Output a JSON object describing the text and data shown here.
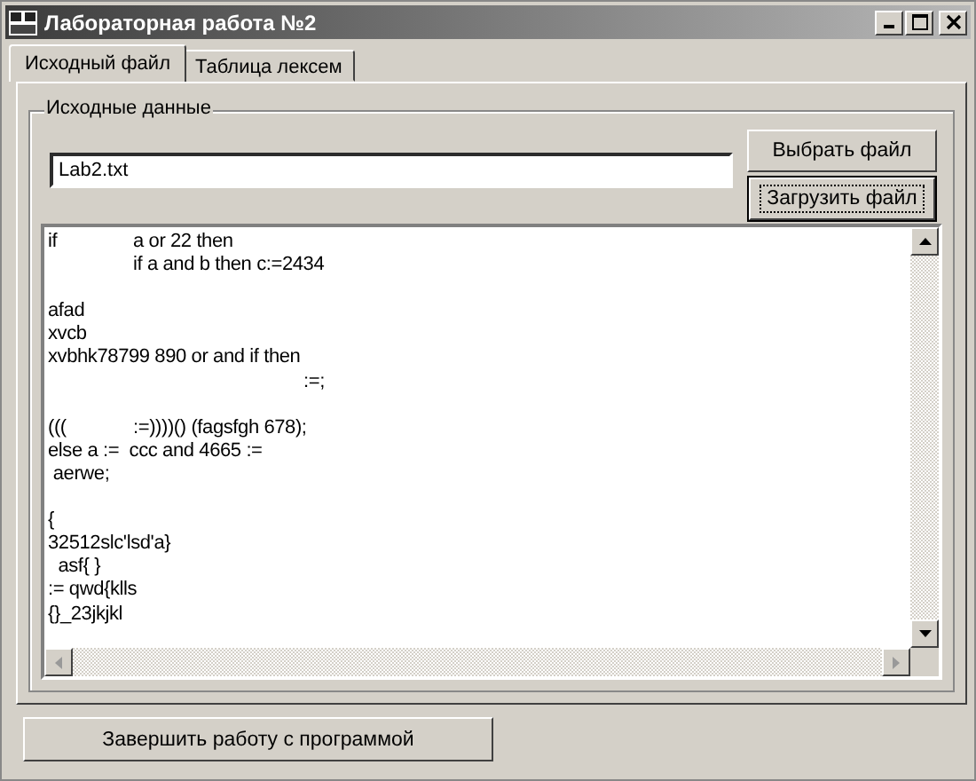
{
  "window": {
    "title": "Лабораторная работа №2"
  },
  "tabs": [
    {
      "label": "Исходный файл",
      "selected": true
    },
    {
      "label": "Таблица лексем",
      "selected": false
    }
  ],
  "group": {
    "title": "Исходные данные",
    "file_field": {
      "value": "Lab2.txt"
    },
    "buttons": [
      {
        "label": "Выбрать файл",
        "default": false
      },
      {
        "label": "Загрузить файл",
        "default": true
      }
    ],
    "memo": {
      "text": "if\ta or 22 then\n\tif a and b then c:=2434\n\nafad\nxvcb\nxvbhk78799 890 or and if then\n\t\t\t:=;\n\n(((\t:=))))() (fagsfgh 678);\nelse a :=  ccc and 4665 :=\n aerwe;\n\n{\n32512slc'lsd'a}\n  asf{ }\n:= qwd{klls\n{}_23jkjkl"
    }
  },
  "exit_button": {
    "label": "Завершить работу с программой"
  }
}
